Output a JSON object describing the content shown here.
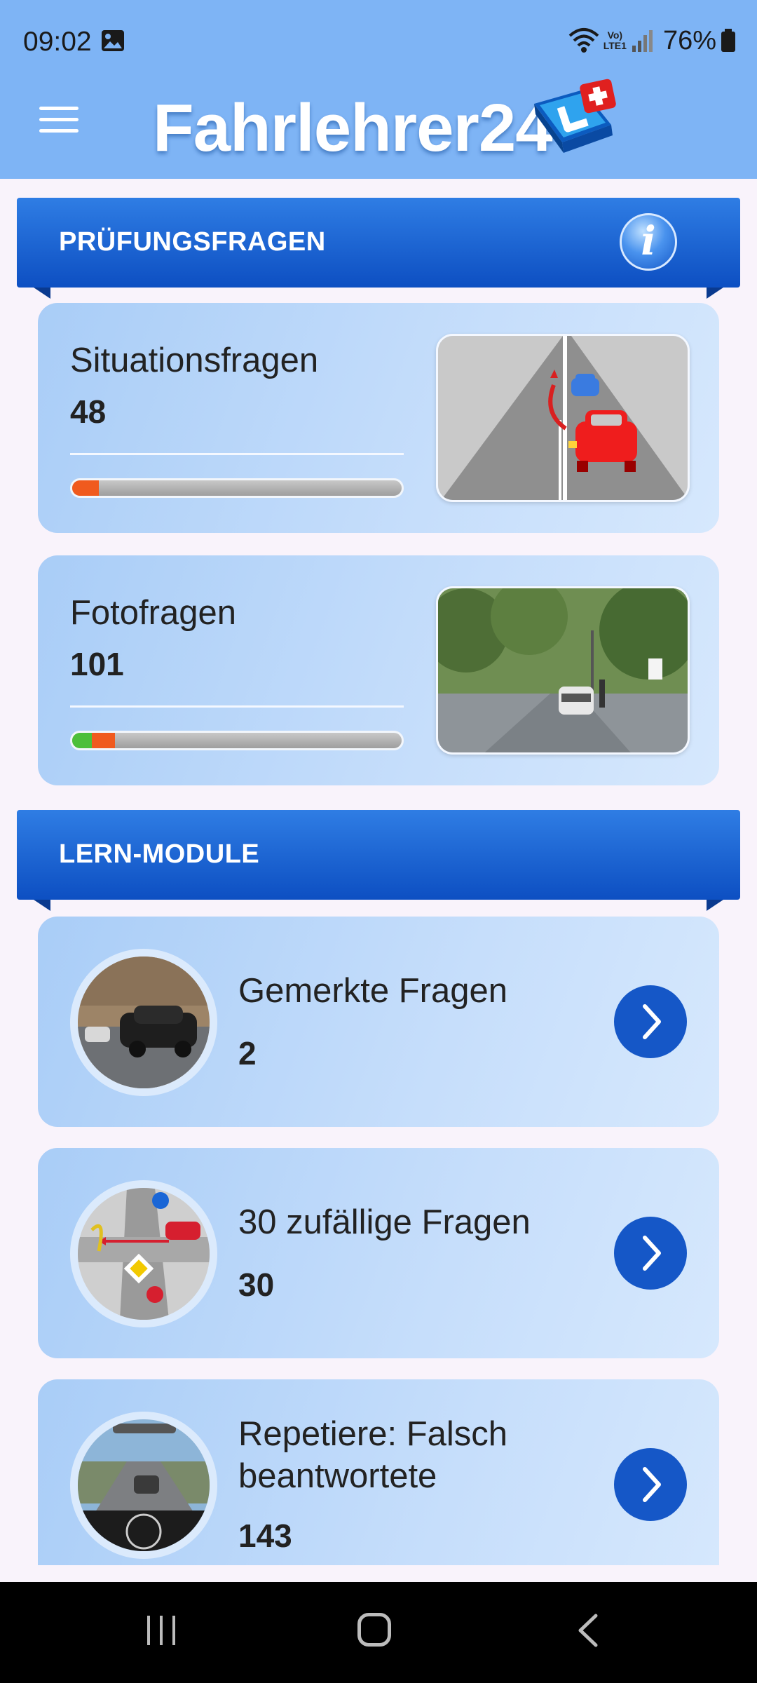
{
  "status_bar": {
    "time": "09:02",
    "battery": "76%",
    "network_top": "Vo)",
    "network_bottom": "LTE1"
  },
  "app_bar": {
    "title": "Fahrlehrer24"
  },
  "sections": {
    "exam": {
      "title": "PRÜFUNGSFRAGEN"
    },
    "learn": {
      "title": "LERN-MODULE"
    }
  },
  "exam_cards": [
    {
      "title": "Situationsfragen",
      "count": "48",
      "progress": {
        "correct_fraction": 0.0,
        "wrong_fraction": 0.08
      }
    },
    {
      "title": "Fotofragen",
      "count": "101",
      "progress": {
        "correct_fraction": 0.06,
        "wrong_fraction": 0.07
      }
    }
  ],
  "modules": [
    {
      "title": "Gemerkte Fragen",
      "count": "2"
    },
    {
      "title": "30 zufällige Fragen",
      "count": "30"
    },
    {
      "title": "Repetiere: Falsch beantwortete",
      "count": "143"
    }
  ],
  "colors": {
    "header": "#7eb4f5",
    "banner": "#0d4fc2",
    "accent_button": "#1557c7",
    "progress_wrong": "#f05a1e",
    "progress_correct": "#4cbf3a"
  }
}
